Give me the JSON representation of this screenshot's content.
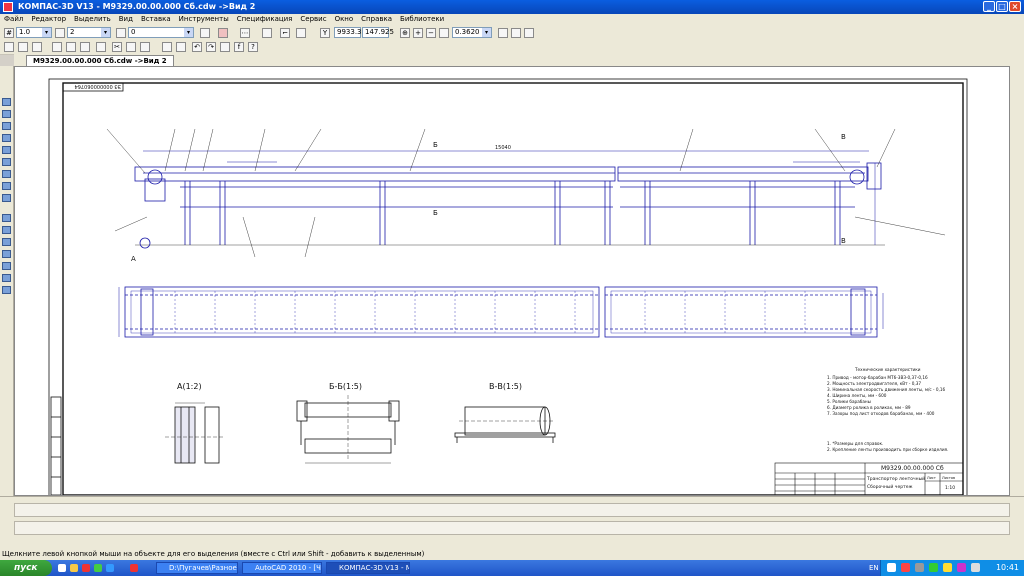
{
  "window": {
    "title": "КОМПАС-3D V13 - М9329.00.00.000 Сб.cdw ->Вид 2"
  },
  "menu": [
    "Файл",
    "Редактор",
    "Выделить",
    "Вид",
    "Вставка",
    "Инструменты",
    "Спецификация",
    "Сервис",
    "Окно",
    "Справка",
    "Библиотеки"
  ],
  "toolbar1": {
    "step": "1.0",
    "layer": "2",
    "view": "0",
    "coord_x": "9933.32",
    "coord_y": "147.925",
    "zoom": "0.3620"
  },
  "document_tab": "М9329.00.00.000 Сб.cdw ->Вид 2",
  "drawing": {
    "stamp_top": "Э3 000000060764",
    "dimension_length": "15040",
    "section_a": "А(1:2)",
    "section_b": "Б-Б(1:5)",
    "section_v": "В-В(1:5)",
    "label_b": "Б",
    "label_v": "В",
    "label_a": "А",
    "tech_heading": "Технические характеристики",
    "tech_lines": [
      "1. Привод - мотор-барабан МТ6-3ВЗ-0,37-0,16",
      "2. Мощность электродвигателя, кВт        - 0,37",
      "3. Номинальная скорость движения ленты, м/с  - 0,16",
      "4. Ширина ленты, мм                      - 600",
      "5. Ролики барабаны",
      "6. Диаметр ролика в роликах, мм           - 89",
      "7. Зазоры под лист отходов барабанах, мм   - 400"
    ],
    "notes": [
      "1. *Размеры для справок.",
      "2. Крепление ленты производить при сборке изделия."
    ],
    "designation": "М9329.00.00.000 Сб",
    "product_name": "Транспортер ленточный",
    "doc_kind": "Сборочный чертеж",
    "sheet_label": "Лист",
    "sheets_label": "Листов",
    "scale": "1:10"
  },
  "status_text": "Щелкните левой кнопкой мыши на объекте для его выделения (вместе с Ctrl или Shift - добавить к выделенным)",
  "taskbar": {
    "start": "пуск",
    "tasks": [
      "D:\\Пугачев\\Разное\\...",
      "AutoCAD 2010 - [Черт...",
      "КОМПАС-3D V13 - М..."
    ],
    "lang": "EN",
    "clock": "10:41"
  }
}
